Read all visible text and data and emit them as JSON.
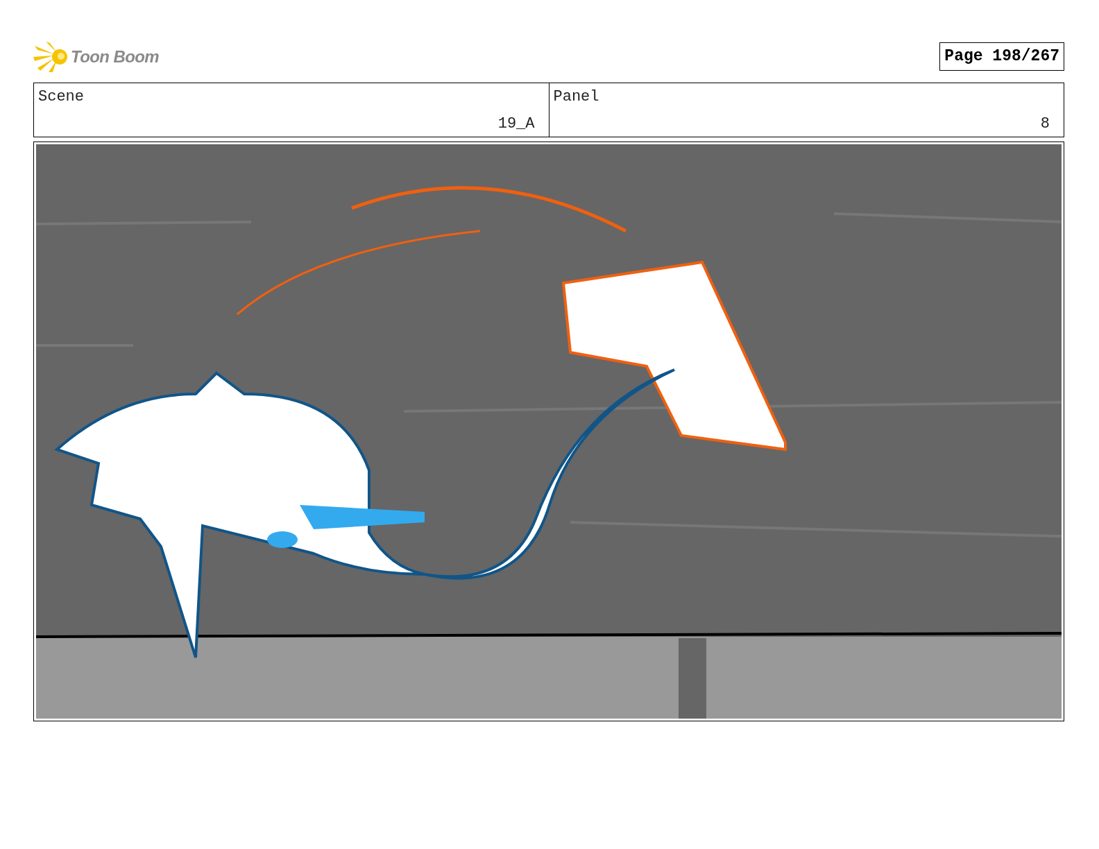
{
  "logo": {
    "text": "Toon Boom"
  },
  "page_label": "Page 198/267",
  "fields": [
    {
      "label": "Scene",
      "value": "19_A"
    },
    {
      "label": "Panel",
      "value": "8"
    }
  ]
}
